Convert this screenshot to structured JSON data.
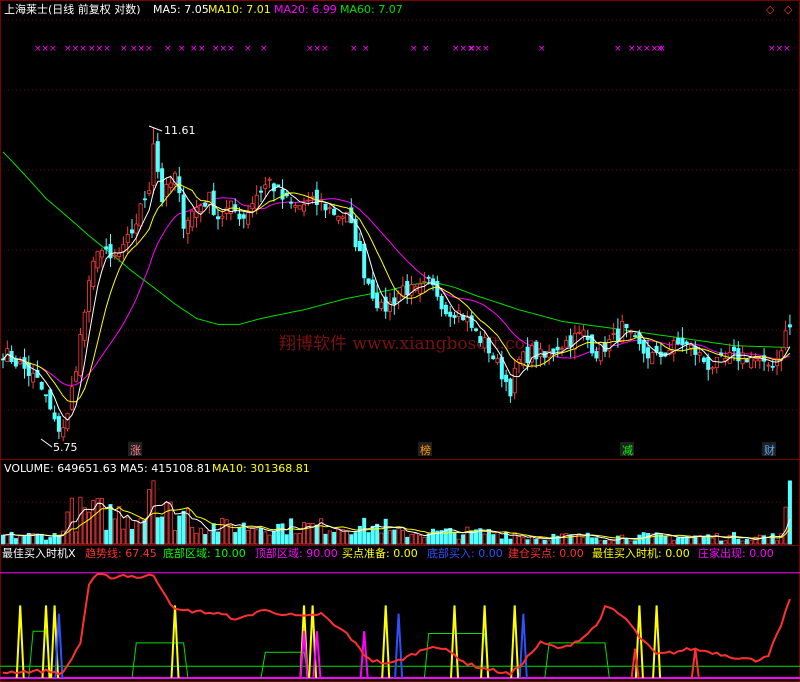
{
  "colors": {
    "bg": "#000000",
    "grid": "#7a0000",
    "up": "#ff3c3c",
    "down": "#54ffff",
    "ma5": "#ffffff",
    "ma10": "#ffff00",
    "ma20": "#ff00ff",
    "ma60": "#00e000",
    "label_white": "#ffffff",
    "label_red": "#ff3030",
    "label_yellow": "#ffff00",
    "label_magenta": "#ff00ff",
    "label_blue": "#3050ff",
    "label_green": "#00ff00"
  },
  "price_panel": {
    "title": "上海莱士(日线 前复权 对数)",
    "ma_labels": [
      {
        "key": "ma5",
        "text": "MA5: 7.05"
      },
      {
        "key": "ma10",
        "text": "MA10: 7.01"
      },
      {
        "key": "ma20",
        "text": "MA20: 6.99"
      },
      {
        "key": "ma60",
        "text": "MA60: 7.07"
      }
    ],
    "high_label": "11.61",
    "low_label": "5.75",
    "watermark": "翔博软件 www.xiangbosoft.com",
    "event_tags": [
      "涨",
      "榜",
      "减",
      "财"
    ],
    "top_marks": [
      "×××",
      "×××",
      "×××",
      "×",
      "×××",
      "×",
      "×",
      "×",
      "×",
      "×××",
      "×",
      "×",
      "×××",
      "×",
      "×",
      "×",
      "×",
      "××××",
      "×",
      "×",
      "×",
      "×",
      "×××××",
      "×",
      "×××"
    ],
    "corner_icons": [
      "◇",
      "◇"
    ]
  },
  "volume_panel": {
    "labels": [
      {
        "key": "label_white",
        "text": "VOLUME: 649651.63"
      },
      {
        "key": "label_white",
        "text": "MA5: 415108.81"
      },
      {
        "key": "label_yellow",
        "text": "MA10: 301368.81"
      }
    ]
  },
  "indicator_panel": {
    "labels": [
      {
        "key": "label_white",
        "text": "最佳买入时机X"
      },
      {
        "key": "label_red",
        "text": "趋势线: 67.45"
      },
      {
        "key": "label_green",
        "text": "底部区域: 10.00"
      },
      {
        "key": "label_magenta",
        "text": "顶部区域: 90.00"
      },
      {
        "key": "label_yellow",
        "text": "买点准备: 0.00"
      },
      {
        "key": "label_blue",
        "text": "底部买入: 0.00"
      },
      {
        "key": "label_red",
        "text": "建仓买点: 0.00"
      },
      {
        "key": "label_yellow",
        "text": "最佳买入时机: 0.00"
      },
      {
        "key": "label_magenta",
        "text": "庄家出现: 0.00"
      }
    ]
  },
  "chart_data": {
    "type": "candlestick",
    "scale": "log",
    "price_range": [
      5.75,
      11.61
    ],
    "ma_last": {
      "ma5": 7.05,
      "ma10": 7.01,
      "ma20": 6.99,
      "ma60": 7.07
    },
    "volume_last": 649651.63,
    "volume_ma5": 415108.81,
    "volume_ma10": 301368.81,
    "indicator_range": [
      0,
      100
    ],
    "indicator_last": {
      "trend": 67.45,
      "bottom_zone": 10.0,
      "top_zone": 90.0,
      "buy_ready": 0.0,
      "bottom_buy": 0.0,
      "build_buy": 0.0,
      "best_buy": 0.0,
      "banker": 0.0
    },
    "close_anchors": [
      [
        0,
        7.0
      ],
      [
        4,
        6.8
      ],
      [
        8,
        6.55
      ],
      [
        10,
        6.3
      ],
      [
        12,
        5.95
      ],
      [
        13,
        5.8
      ],
      [
        15,
        6.05
      ],
      [
        17,
        6.8
      ],
      [
        20,
        8.1
      ],
      [
        22,
        8.9
      ],
      [
        25,
        8.6
      ],
      [
        28,
        8.8
      ],
      [
        31,
        9.4
      ],
      [
        34,
        10.2
      ],
      [
        35,
        11.2
      ],
      [
        37,
        9.9
      ],
      [
        40,
        10.4
      ],
      [
        42,
        9.4
      ],
      [
        45,
        9.7
      ],
      [
        48,
        9.9
      ],
      [
        50,
        9.5
      ],
      [
        53,
        9.7
      ],
      [
        56,
        9.5
      ],
      [
        59,
        10.0
      ],
      [
        62,
        10.3
      ],
      [
        65,
        9.9
      ],
      [
        68,
        9.7
      ],
      [
        71,
        9.8
      ],
      [
        74,
        9.8
      ],
      [
        77,
        9.6
      ],
      [
        80,
        9.5
      ],
      [
        82,
        9.0
      ],
      [
        84,
        8.4
      ],
      [
        86,
        8.0
      ],
      [
        88,
        7.7
      ],
      [
        90,
        7.8
      ],
      [
        93,
        8.1
      ],
      [
        96,
        8.0
      ],
      [
        99,
        8.15
      ],
      [
        101,
        8.0
      ],
      [
        103,
        7.7
      ],
      [
        105,
        7.7
      ],
      [
        107,
        7.6
      ],
      [
        110,
        7.3
      ],
      [
        113,
        7.05
      ],
      [
        115,
        6.8
      ],
      [
        117,
        6.55
      ],
      [
        118,
        6.45
      ],
      [
        120,
        6.85
      ],
      [
        123,
        7.0
      ],
      [
        126,
        6.9
      ],
      [
        129,
        7.1
      ],
      [
        132,
        7.2
      ],
      [
        135,
        7.3
      ],
      [
        138,
        7.0
      ],
      [
        140,
        7.1
      ],
      [
        142,
        7.2
      ],
      [
        144,
        7.4
      ],
      [
        146,
        7.2
      ],
      [
        149,
        7.0
      ],
      [
        152,
        6.9
      ],
      [
        155,
        7.05
      ],
      [
        158,
        7.15
      ],
      [
        161,
        7.0
      ],
      [
        164,
        6.8
      ],
      [
        166,
        6.8
      ],
      [
        169,
        6.9
      ],
      [
        172,
        6.95
      ],
      [
        175,
        6.9
      ],
      [
        177,
        6.75
      ],
      [
        180,
        6.9
      ],
      [
        182,
        7.3
      ],
      [
        183,
        7.4
      ]
    ],
    "ma60_anchors": [
      [
        0,
        11.0
      ],
      [
        10,
        9.9
      ],
      [
        20,
        9.1
      ],
      [
        30,
        8.4
      ],
      [
        35,
        8.1
      ],
      [
        40,
        7.8
      ],
      [
        45,
        7.55
      ],
      [
        50,
        7.45
      ],
      [
        55,
        7.45
      ],
      [
        60,
        7.55
      ],
      [
        70,
        7.7
      ],
      [
        80,
        7.9
      ],
      [
        90,
        8.05
      ],
      [
        95,
        8.15
      ],
      [
        100,
        8.2
      ],
      [
        105,
        8.1
      ],
      [
        110,
        7.95
      ],
      [
        120,
        7.7
      ],
      [
        130,
        7.5
      ],
      [
        140,
        7.4
      ],
      [
        150,
        7.3
      ],
      [
        160,
        7.2
      ],
      [
        170,
        7.1
      ],
      [
        183,
        7.07
      ]
    ],
    "trend_anchors": [
      [
        0,
        5
      ],
      [
        10,
        6
      ],
      [
        14,
        4
      ],
      [
        18,
        30
      ],
      [
        20,
        80
      ],
      [
        22,
        88
      ],
      [
        26,
        86
      ],
      [
        28,
        88
      ],
      [
        32,
        86
      ],
      [
        35,
        88
      ],
      [
        38,
        70
      ],
      [
        40,
        58
      ],
      [
        45,
        57
      ],
      [
        50,
        55
      ],
      [
        55,
        50
      ],
      [
        60,
        58
      ],
      [
        65,
        55
      ],
      [
        70,
        52
      ],
      [
        74,
        55
      ],
      [
        77,
        45
      ],
      [
        80,
        38
      ],
      [
        84,
        20
      ],
      [
        86,
        15
      ],
      [
        90,
        12
      ],
      [
        94,
        18
      ],
      [
        100,
        28
      ],
      [
        104,
        22
      ],
      [
        108,
        12
      ],
      [
        112,
        8
      ],
      [
        116,
        5
      ],
      [
        118,
        3
      ],
      [
        120,
        10
      ],
      [
        125,
        30
      ],
      [
        130,
        25
      ],
      [
        135,
        35
      ],
      [
        138,
        45
      ],
      [
        140,
        60
      ],
      [
        142,
        58
      ],
      [
        145,
        50
      ],
      [
        148,
        35
      ],
      [
        152,
        20
      ],
      [
        156,
        22
      ],
      [
        160,
        25
      ],
      [
        165,
        22
      ],
      [
        170,
        18
      ],
      [
        175,
        15
      ],
      [
        178,
        20
      ],
      [
        181,
        45
      ],
      [
        183,
        67.45
      ]
    ],
    "spikes": [
      {
        "series": "best_buy",
        "x": 4
      },
      {
        "series": "best_buy",
        "x": 10
      },
      {
        "series": "best_buy",
        "x": 12
      },
      {
        "series": "bottom_buy",
        "x": 13
      },
      {
        "series": "best_buy",
        "x": 40
      },
      {
        "series": "best_buy",
        "x": 70
      },
      {
        "series": "banker",
        "x": 70
      },
      {
        "series": "best_buy",
        "x": 72
      },
      {
        "series": "banker",
        "x": 73
      },
      {
        "series": "banker",
        "x": 84
      },
      {
        "series": "best_buy",
        "x": 89
      },
      {
        "series": "bottom_buy",
        "x": 92
      },
      {
        "series": "best_buy",
        "x": 105
      },
      {
        "series": "best_buy",
        "x": 112
      },
      {
        "series": "best_buy",
        "x": 119
      },
      {
        "series": "bottom_buy",
        "x": 121
      },
      {
        "series": "best_buy",
        "x": 148
      },
      {
        "series": "best_buy",
        "x": 152
      },
      {
        "series": "build_buy",
        "x": 147
      },
      {
        "series": "build_buy",
        "x": 161
      }
    ]
  }
}
